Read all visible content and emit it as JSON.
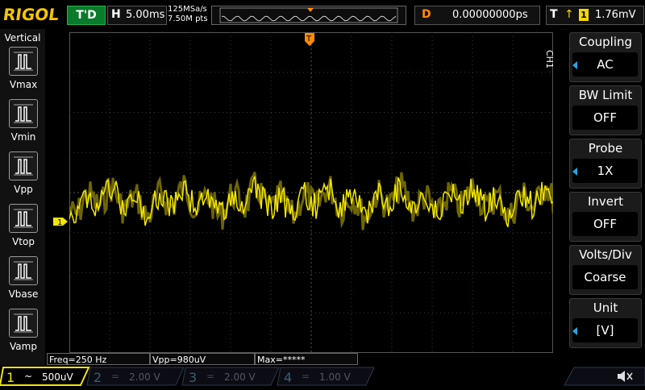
{
  "header": {
    "logo": "RIGOL",
    "run_state": "T'D",
    "horizontal_label": "H",
    "timebase": "5.00ms",
    "sample_rate": "125MSa/s",
    "memory_depth": "7.50M pts",
    "delay_label": "D",
    "delay_value": "0.00000000ps",
    "trigger_label": "T",
    "trigger_edge": "rising-edge-icon",
    "trigger_channel": "1",
    "trigger_level": "1.76mV"
  },
  "left_panel": {
    "title": "Vertical",
    "items": [
      {
        "label": "Vmax",
        "icon": "vmax-icon"
      },
      {
        "label": "Vmin",
        "icon": "vmin-icon"
      },
      {
        "label": "Vpp",
        "icon": "vpp-icon"
      },
      {
        "label": "Vtop",
        "icon": "vtop-icon"
      },
      {
        "label": "Vbase",
        "icon": "vbase-icon"
      },
      {
        "label": "Vamp",
        "icon": "vamp-icon"
      }
    ]
  },
  "right_menu": {
    "channel_tab": "CH1",
    "items": [
      {
        "title": "Coupling",
        "value": "AC",
        "has_arrow": true
      },
      {
        "title": "BW Limit",
        "value": "OFF",
        "has_arrow": false
      },
      {
        "title": "Probe",
        "value": "1X",
        "has_arrow": true
      },
      {
        "title": "Invert",
        "value": "OFF",
        "has_arrow": false
      },
      {
        "title": "Volts/Div",
        "value": "Coarse",
        "has_arrow": false
      },
      {
        "title": "Unit",
        "value": "[V]",
        "has_arrow": true
      }
    ]
  },
  "measurements": {
    "freq": "Freq=250 Hz",
    "vpp": "Vpp=980uV",
    "max": "Max=*****"
  },
  "channels": [
    {
      "num": "1",
      "coupling": "~",
      "scale": "500uV",
      "active": true,
      "color": "#f5e600"
    },
    {
      "num": "2",
      "coupling": "=",
      "scale": "2.00 V",
      "active": false,
      "color": "#2ab0c0"
    },
    {
      "num": "3",
      "coupling": "=",
      "scale": "2.00 V",
      "active": false,
      "color": "#d040d0"
    },
    {
      "num": "4",
      "coupling": "=",
      "scale": "1.00 V",
      "active": false,
      "color": "#3070e0"
    }
  ],
  "ch1_marker": "1",
  "trigger_marker": "T",
  "speaker_icon": "speaker-muted-icon",
  "colors": {
    "ch1": "#f5e600",
    "accent": "#ff8c00",
    "menu_arrow": "#2aa6e0",
    "logo": "#f5c400"
  }
}
